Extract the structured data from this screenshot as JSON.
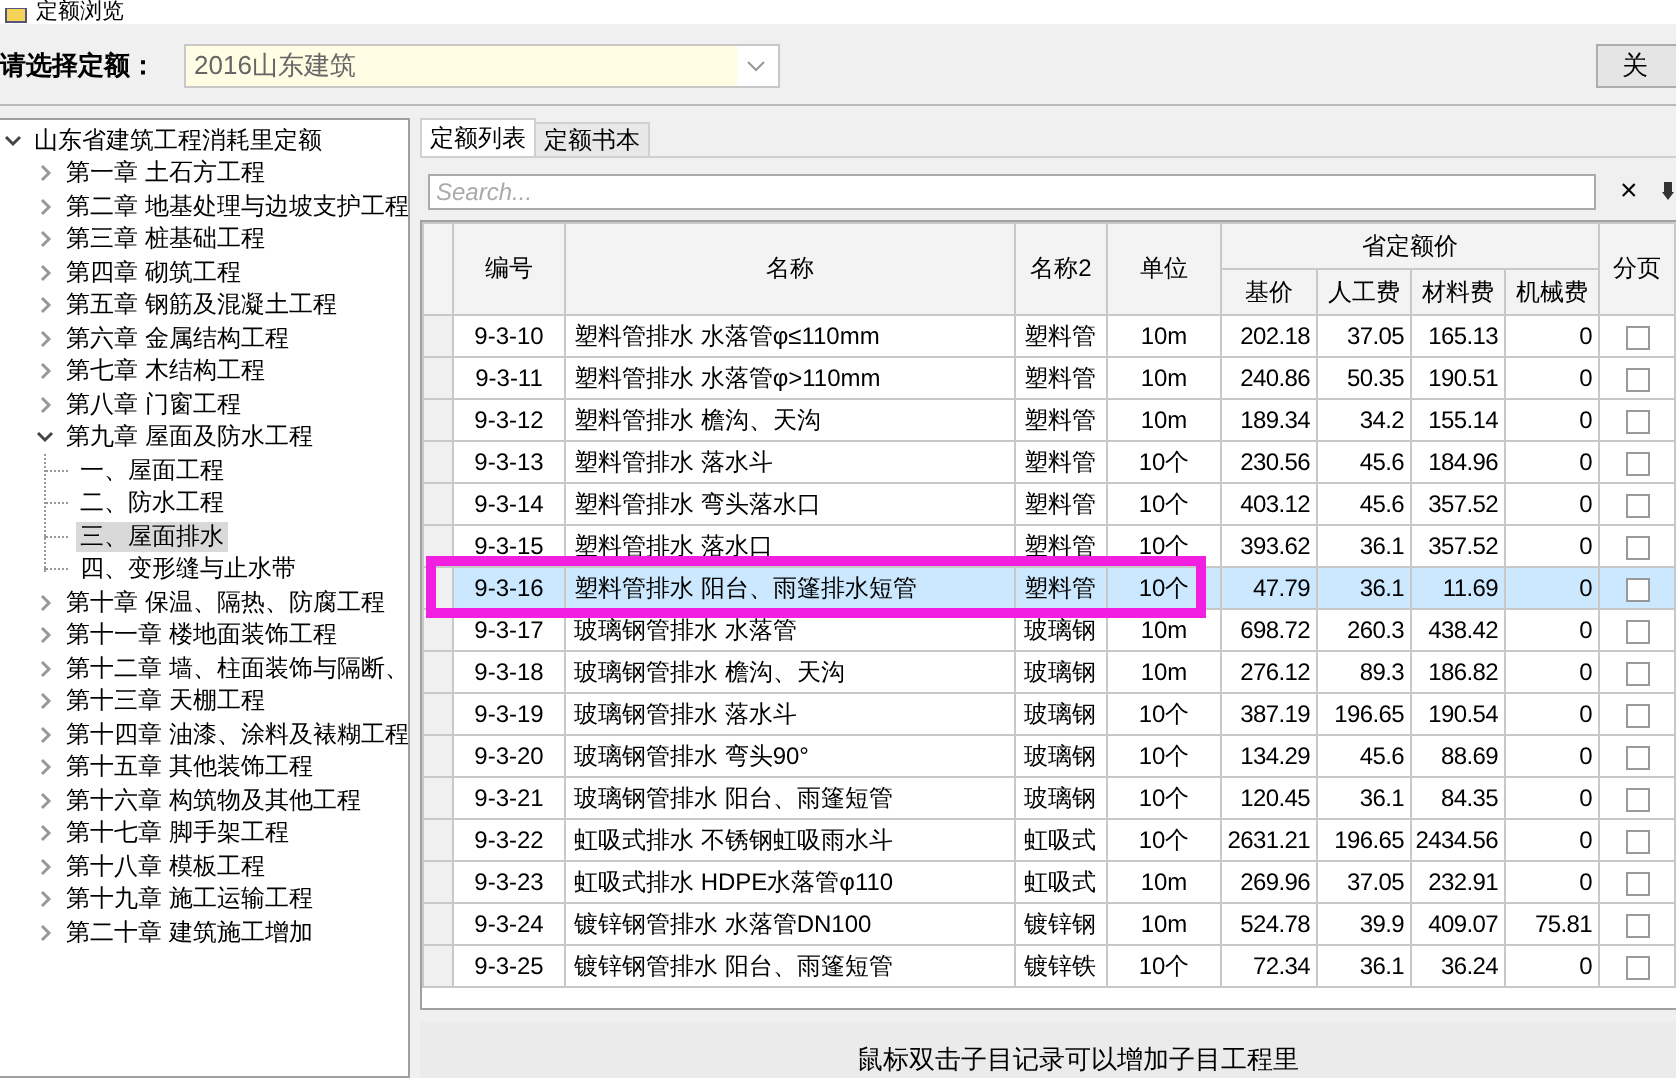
{
  "window": {
    "title": "定额浏览"
  },
  "close_button": "关",
  "selector": {
    "label": "请选择定额：",
    "value": "2016山东建筑"
  },
  "tree": [
    {
      "label": "山东省建筑工程消耗里定额",
      "expanded": true,
      "selected": false,
      "children": [
        {
          "label": "第一章 土石方工程",
          "expanded": false,
          "selected": false
        },
        {
          "label": "第二章 地基处理与边坡支护工程",
          "expanded": false,
          "selected": false
        },
        {
          "label": "第三章 桩基础工程",
          "expanded": false,
          "selected": false
        },
        {
          "label": "第四章 砌筑工程",
          "expanded": false,
          "selected": false
        },
        {
          "label": "第五章 钢筋及混凝土工程",
          "expanded": false,
          "selected": false
        },
        {
          "label": "第六章 金属结构工程",
          "expanded": false,
          "selected": false
        },
        {
          "label": "第七章 木结构工程",
          "expanded": false,
          "selected": false
        },
        {
          "label": "第八章 门窗工程",
          "expanded": false,
          "selected": false
        },
        {
          "label": "第九章 屋面及防水工程",
          "expanded": true,
          "selected": false,
          "children": [
            {
              "label": "一、屋面工程",
              "selected": false
            },
            {
              "label": "二、防水工程",
              "selected": false
            },
            {
              "label": "三、屋面排水",
              "selected": true
            },
            {
              "label": "四、变形缝与止水带",
              "selected": false
            }
          ]
        },
        {
          "label": "第十章 保温、隔热、防腐工程",
          "expanded": false,
          "selected": false
        },
        {
          "label": "第十一章 楼地面装饰工程",
          "expanded": false,
          "selected": false
        },
        {
          "label": "第十二章 墙、柱面装饰与隔断、",
          "expanded": false,
          "selected": false
        },
        {
          "label": "第十三章 天棚工程",
          "expanded": false,
          "selected": false
        },
        {
          "label": "第十四章 油漆、涂料及裱糊工程",
          "expanded": false,
          "selected": false
        },
        {
          "label": "第十五章 其他装饰工程",
          "expanded": false,
          "selected": false
        },
        {
          "label": "第十六章 构筑物及其他工程",
          "expanded": false,
          "selected": false
        },
        {
          "label": "第十七章 脚手架工程",
          "expanded": false,
          "selected": false
        },
        {
          "label": "第十八章 模板工程",
          "expanded": false,
          "selected": false
        },
        {
          "label": "第十九章 施工运输工程",
          "expanded": false,
          "selected": false
        },
        {
          "label": "第二十章 建筑施工增加",
          "expanded": false,
          "selected": false
        }
      ]
    }
  ],
  "tabs": [
    {
      "label": "定额列表",
      "selected": true
    },
    {
      "label": "定额书本",
      "selected": false
    }
  ],
  "search": {
    "placeholder": "Search...",
    "clear": "×"
  },
  "table": {
    "group_header": "省定额价",
    "columns": [
      "编号",
      "名称",
      "名称2",
      "单位",
      "基价",
      "人工费",
      "材料费",
      "机械费",
      "分页"
    ],
    "rows": [
      {
        "cells": [
          "9-3-10",
          "塑料管排水 水落管φ≤110mm",
          "塑料管",
          "10m",
          "202.18",
          "37.05",
          "165.13",
          "0"
        ],
        "paged": false,
        "selected": false,
        "highlighted": false
      },
      {
        "cells": [
          "9-3-11",
          "塑料管排水 水落管φ>110mm",
          "塑料管",
          "10m",
          "240.86",
          "50.35",
          "190.51",
          "0"
        ],
        "paged": false,
        "selected": false,
        "highlighted": false
      },
      {
        "cells": [
          "9-3-12",
          "塑料管排水 檐沟、天沟",
          "塑料管",
          "10m",
          "189.34",
          "34.2",
          "155.14",
          "0"
        ],
        "paged": false,
        "selected": false,
        "highlighted": false
      },
      {
        "cells": [
          "9-3-13",
          "塑料管排水 落水斗",
          "塑料管",
          "10个",
          "230.56",
          "45.6",
          "184.96",
          "0"
        ],
        "paged": false,
        "selected": false,
        "highlighted": false
      },
      {
        "cells": [
          "9-3-14",
          "塑料管排水 弯头落水口",
          "塑料管",
          "10个",
          "403.12",
          "45.6",
          "357.52",
          "0"
        ],
        "paged": false,
        "selected": false,
        "highlighted": false
      },
      {
        "cells": [
          "9-3-15",
          "塑料管排水 落水口",
          "塑料管",
          "10个",
          "393.62",
          "36.1",
          "357.52",
          "0"
        ],
        "paged": false,
        "selected": false,
        "highlighted": false
      },
      {
        "cells": [
          "9-3-16",
          "塑料管排水 阳台、雨篷排水短管",
          "塑料管",
          "10个",
          "47.79",
          "36.1",
          "11.69",
          "0"
        ],
        "paged": false,
        "selected": true,
        "highlighted": true
      },
      {
        "cells": [
          "9-3-17",
          "玻璃钢管排水 水落管",
          "玻璃钢",
          "10m",
          "698.72",
          "260.3",
          "438.42",
          "0"
        ],
        "paged": false,
        "selected": false,
        "highlighted": false
      },
      {
        "cells": [
          "9-3-18",
          "玻璃钢管排水 檐沟、天沟",
          "玻璃钢",
          "10m",
          "276.12",
          "89.3",
          "186.82",
          "0"
        ],
        "paged": false,
        "selected": false,
        "highlighted": false
      },
      {
        "cells": [
          "9-3-19",
          "玻璃钢管排水 落水斗",
          "玻璃钢",
          "10个",
          "387.19",
          "196.65",
          "190.54",
          "0"
        ],
        "paged": false,
        "selected": false,
        "highlighted": false
      },
      {
        "cells": [
          "9-3-20",
          "玻璃钢管排水 弯头90°",
          "玻璃钢",
          "10个",
          "134.29",
          "45.6",
          "88.69",
          "0"
        ],
        "paged": false,
        "selected": false,
        "highlighted": false
      },
      {
        "cells": [
          "9-3-21",
          "玻璃钢管排水 阳台、雨篷短管",
          "玻璃钢",
          "10个",
          "120.45",
          "36.1",
          "84.35",
          "0"
        ],
        "paged": false,
        "selected": false,
        "highlighted": false
      },
      {
        "cells": [
          "9-3-22",
          "虹吸式排水 不锈钢虹吸雨水斗",
          "虹吸式",
          "10个",
          "2631.21",
          "196.65",
          "2434.56",
          "0"
        ],
        "paged": false,
        "selected": false,
        "highlighted": false
      },
      {
        "cells": [
          "9-3-23",
          "虹吸式排水 HDPE水落管φ110",
          "虹吸式",
          "10m",
          "269.96",
          "37.05",
          "232.91",
          "0"
        ],
        "paged": false,
        "selected": false,
        "highlighted": false
      },
      {
        "cells": [
          "9-3-24",
          "镀锌钢管排水 水落管DN100",
          "镀锌钢",
          "10m",
          "524.78",
          "39.9",
          "409.07",
          "75.81"
        ],
        "paged": false,
        "selected": false,
        "highlighted": false
      },
      {
        "cells": [
          "9-3-25",
          "镀锌钢管排水 阳台、雨篷短管",
          "镀锌铁",
          "10个",
          "72.34",
          "36.1",
          "36.24",
          "0"
        ],
        "paged": false,
        "selected": false,
        "highlighted": false
      }
    ]
  },
  "hint": "鼠标双击子目记录可以增加子目工程里"
}
